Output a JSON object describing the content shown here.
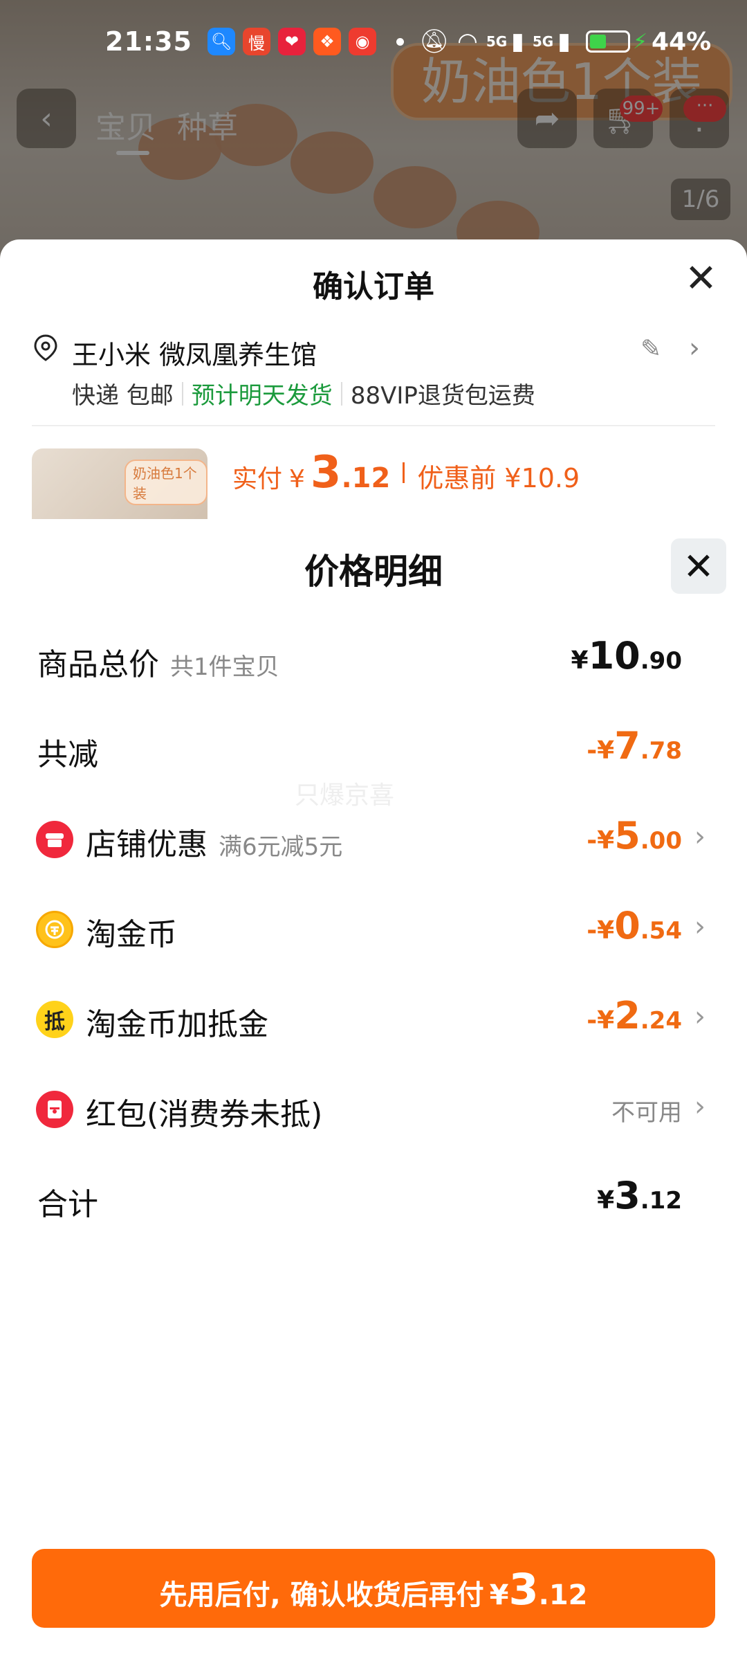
{
  "status_bar": {
    "time": "21:35",
    "network_1": "5G",
    "network_2": "5G",
    "battery_pct": "44%",
    "battery_level": 0.44
  },
  "background_page": {
    "nav_tabs": [
      "宝贝",
      "种草"
    ],
    "cart_badge": "99+",
    "more_badge": "···",
    "image_counter": "1/6",
    "hero_badge_text": "奶油色1个装"
  },
  "order_sheet": {
    "title": "确认订单",
    "address": "王小米 微凤凰养生馆",
    "shipping": [
      "快递 包邮",
      "预计明天发货",
      "88VIP退货包运费"
    ],
    "thumb_tag": "奶油色1个装",
    "pay_label": "实付",
    "pay_yen": "¥",
    "pay_int": "3",
    "pay_dec": ".12",
    "before_label": "优惠前 ¥10.9"
  },
  "price_detail": {
    "title": "价格明细",
    "watermark": "只爆京喜",
    "rows": [
      {
        "label": "商品总价",
        "sub": "共1件宝贝",
        "yen": "¥",
        "int": "10",
        "dec": ".90"
      },
      {
        "label": "共减",
        "yen": "-¥",
        "int": "7",
        "dec": ".78"
      },
      {
        "label": "店铺优惠",
        "sub": "满6元减5元",
        "yen": "-¥",
        "int": "5",
        "dec": ".00",
        "icon": "shop-icon"
      },
      {
        "label": "淘金币",
        "yen": "-¥",
        "int": "0",
        "dec": ".54",
        "icon": "coin-icon"
      },
      {
        "label": "淘金币加抵金",
        "yen": "-¥",
        "int": "2",
        "dec": ".24",
        "icon": "deduct-icon",
        "icon_text": "抵"
      },
      {
        "label": "红包(消费券未抵)",
        "status": "不可用",
        "icon": "red-packet-icon"
      },
      {
        "label": "合计",
        "yen": "¥",
        "int": "3",
        "dec": ".12"
      }
    ]
  },
  "cta": {
    "text": "先用后付, 确认收货后再付",
    "yen": "¥",
    "int": "3",
    "dec": ".12"
  },
  "colors": {
    "accent_orange": "#ff6a0a",
    "discount_orange": "#f06a12",
    "green": "#1b9a3c"
  }
}
